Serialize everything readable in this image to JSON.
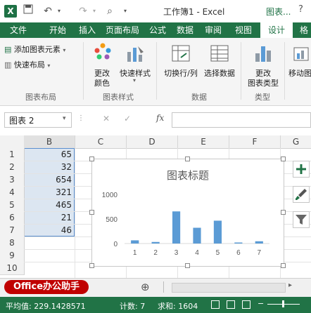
{
  "window": {
    "title": "工作簿1 - Excel",
    "contextual_tab": "图表..."
  },
  "tabs": [
    "文件",
    "开始",
    "插入",
    "页面布局",
    "公式",
    "数据",
    "审阅",
    "视图",
    "设计",
    "格"
  ],
  "active_tab": "设计",
  "ribbon": {
    "add_element": "添加图表元素",
    "quick_layout": "快速布局",
    "group_layout": "图表布局",
    "change_color_1": "更改",
    "change_color_2": "颜色",
    "quick_style": "快速样式",
    "group_style": "图表样式",
    "switch_row_col": "切换行/列",
    "select_data": "选择数据",
    "group_data": "数据",
    "change_type_1": "更改",
    "change_type_2": "图表类型",
    "group_type": "类型",
    "move_chart": "移动图"
  },
  "formula_bar": {
    "name_box": "图表 2",
    "fx": "fx",
    "formula": ""
  },
  "columns": [
    "B",
    "C",
    "D",
    "E",
    "F",
    "G"
  ],
  "rows": [
    "1",
    "2",
    "3",
    "4",
    "5",
    "6",
    "7",
    "8",
    "9",
    "10"
  ],
  "cells_b": [
    "65",
    "32",
    "654",
    "321",
    "465",
    "21",
    "46"
  ],
  "chart_data": {
    "type": "bar",
    "title": "图表标题",
    "categories": [
      "1",
      "2",
      "3",
      "4",
      "5",
      "6",
      "7"
    ],
    "values": [
      65,
      32,
      654,
      321,
      465,
      21,
      46
    ],
    "y_ticks": [
      "0",
      "500",
      "1000"
    ],
    "ylim": [
      0,
      1000
    ],
    "grid": false,
    "bar_color": "#5b9bd5"
  },
  "sheet_tab": "Office办公助手",
  "add_sheet": "⊕",
  "status": {
    "average": "平均值: 229.1428571",
    "count": "计数: 7",
    "sum": "求和: 1604"
  },
  "colors": {
    "excel_green": "#217346",
    "selection": "#dce6f1"
  }
}
